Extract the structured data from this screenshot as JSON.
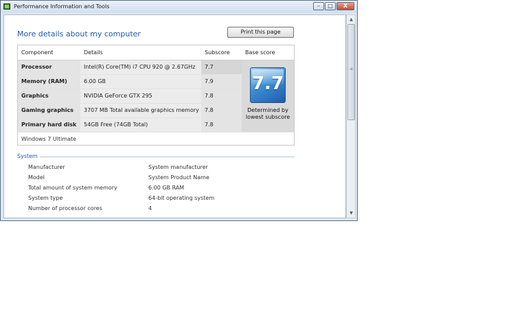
{
  "window": {
    "title": "Performance Information and Tools",
    "controls": {
      "minimize": "–",
      "maximize": "□",
      "close": "X"
    }
  },
  "page": {
    "title": "More details about my computer",
    "print_button": "Print this page"
  },
  "score_table": {
    "headers": {
      "component": "Component",
      "details": "Details",
      "subscore": "Subscore",
      "base_score": "Base score"
    },
    "rows": [
      {
        "component": "Processor",
        "details": "Intel(R) Core(TM) i7 CPU 920 @ 2.67GHz",
        "subscore": "7.7"
      },
      {
        "component": "Memory (RAM)",
        "details": "6.00 GB",
        "subscore": "7.9"
      },
      {
        "component": "Graphics",
        "details": "NVIDIA GeForce GTX 295",
        "subscore": "7.8"
      },
      {
        "component": "Gaming graphics",
        "details": "3707 MB Total available graphics memory",
        "subscore": "7.8"
      },
      {
        "component": "Primary hard disk",
        "details": "54GB Free (74GB Total)",
        "subscore": "7.8"
      }
    ],
    "base_score": "7.7",
    "base_score_note": "Determined by lowest subscore",
    "os_edition": "Windows 7 Ultimate"
  },
  "system": {
    "section_title": "System",
    "rows": [
      {
        "label": "Manufacturer",
        "value": "System manufacturer"
      },
      {
        "label": "Model",
        "value": "System Product Name"
      },
      {
        "label": "Total amount of system memory",
        "value": "6.00 GB RAM"
      },
      {
        "label": "System type",
        "value": "64-bit operating system"
      },
      {
        "label": "Number of processor cores",
        "value": "4"
      }
    ]
  },
  "scrollbar": {
    "up_arrow": "▲",
    "down_arrow": "▼",
    "grip": "≡"
  },
  "colors": {
    "accent": "#1e5aa8",
    "frame": "#dfe8f3",
    "close_button": "#c44b31"
  }
}
